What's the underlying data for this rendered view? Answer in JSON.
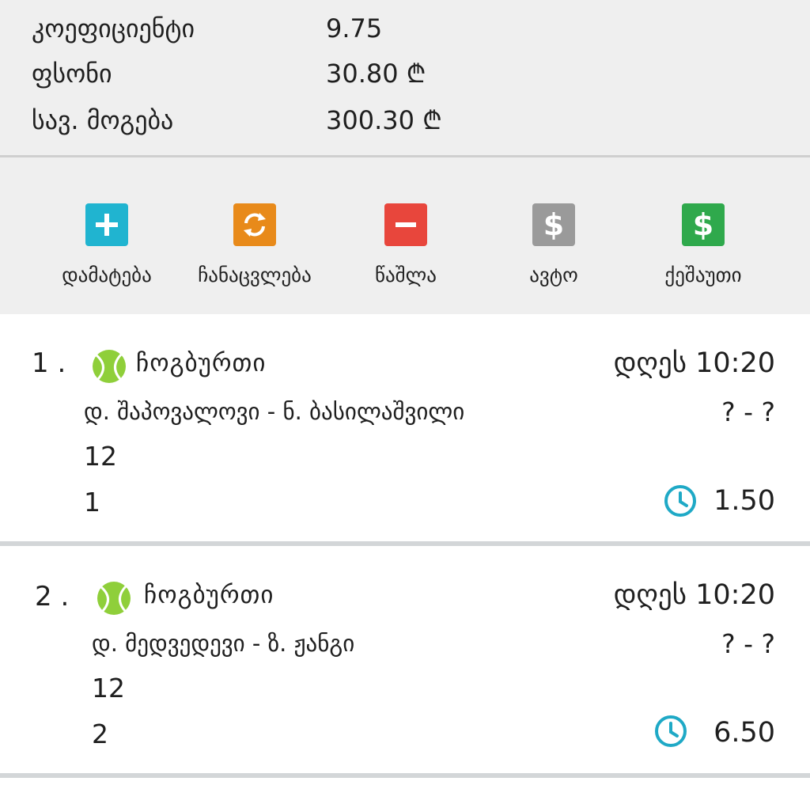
{
  "summary": {
    "coef_label": "კოეფიციენტი",
    "coef_value": "9.75",
    "stake_label": "ფსონი",
    "stake_value": "30.80 ₾",
    "win_label": "სავ. მოგება",
    "win_value": "300.30 ₾"
  },
  "actions": [
    {
      "label": "დამატება",
      "icon": "plus-icon",
      "color": "#20b4d0"
    },
    {
      "label": "ჩანაცვლება",
      "icon": "refresh-icon",
      "color": "#e88a1a"
    },
    {
      "label": "წაშლა",
      "icon": "minus-icon",
      "color": "#e8463c"
    },
    {
      "label": "ავტო",
      "icon": "dollar-icon",
      "color": "#9a9a9a"
    },
    {
      "label": "ქეშაუთი",
      "icon": "dollar-icon",
      "color": "#2fa94c"
    }
  ],
  "events": [
    {
      "number": "1 .",
      "sport": "ჩოგბურთი",
      "time": "დღეს 10:20",
      "teams": "დ. შაპოვალოვი - ნ. ბასილაშვილი",
      "score": "? - ?",
      "market": "12",
      "pick": "1",
      "odd": "1.50"
    },
    {
      "number": "2 .",
      "sport": "ჩოგბურთი",
      "time": "დღეს 10:20",
      "teams": "დ. მედვედევი - ზ. ჟანგი",
      "score": "? - ?",
      "market": "12",
      "pick": "2",
      "odd": "6.50"
    }
  ],
  "colors": {
    "clock": "#1fa9c6",
    "ball": "#8fcf3a"
  }
}
